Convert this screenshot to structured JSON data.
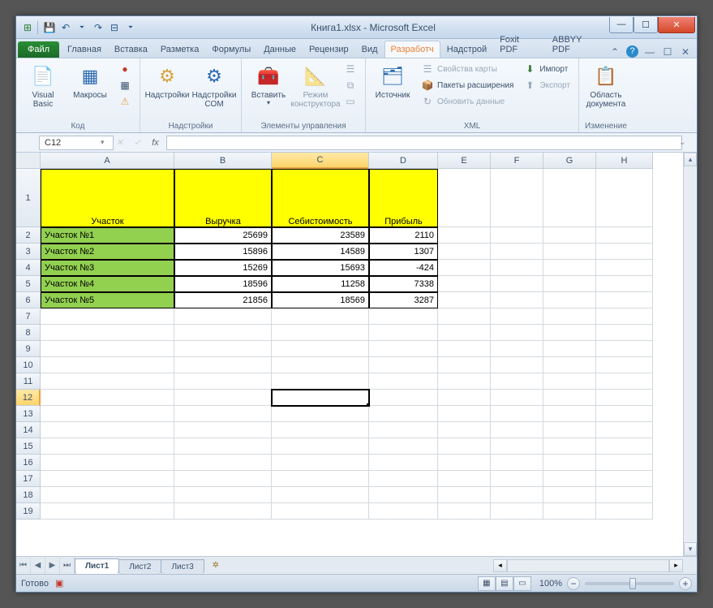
{
  "title": "Книга1.xlsx - Microsoft Excel",
  "qat": {
    "save": "💾",
    "undo": "↶",
    "redo": "↷",
    "more": "⏷"
  },
  "winbtns": {
    "min": "—",
    "max": "☐",
    "close": "✕"
  },
  "tabs": {
    "file": "Файл",
    "items": [
      "Главная",
      "Вставка",
      "Разметка",
      "Формулы",
      "Данные",
      "Рецензир",
      "Вид",
      "Разработч",
      "Надстрой",
      "Foxit PDF",
      "ABBYY PDF"
    ],
    "active": "Разработч"
  },
  "ribHelp": {
    "caret": "⌃",
    "help": "?",
    "minr": "—",
    "restr": "☐",
    "closer": "✕"
  },
  "ribbon": {
    "g1": {
      "vb": "Visual\nBasic",
      "mac": "Макросы",
      "label": "Код"
    },
    "g2": {
      "add": "Надстройки",
      "com": "Надстройки\nCOM",
      "label": "Надстройки"
    },
    "g3": {
      "ins": "Вставить",
      "des": "Режим\nконструктора",
      "label": "Элементы управления"
    },
    "g4": {
      "src": "Источник",
      "prop": "Свойства карты",
      "exp": "Пакеты расширения",
      "upd": "Обновить данные",
      "imp": "Импорт",
      "expo": "Экспорт",
      "label": "XML"
    },
    "g5": {
      "doc": "Область\nдокумента",
      "label": "Изменение"
    }
  },
  "namebox": "C12",
  "fx": "fx",
  "cols": [
    "A",
    "B",
    "C",
    "D",
    "E",
    "F",
    "G",
    "H"
  ],
  "colW": {
    "A": 165,
    "B": 120,
    "C": 120,
    "D": 85,
    "E": 65,
    "F": 65,
    "G": 65,
    "H": 70
  },
  "rowH": {
    "1": 72,
    "def": 20
  },
  "headers": [
    "Участок",
    "Выручка",
    "Себистоимость",
    "Прибыль"
  ],
  "data": [
    {
      "lab": "Участок №1",
      "b": "25699",
      "c": "23589",
      "d": "2110"
    },
    {
      "lab": "Участок №2",
      "b": "15896",
      "c": "14589",
      "d": "1307"
    },
    {
      "lab": "Участок №3",
      "b": "15269",
      "c": "15693",
      "d": "-424"
    },
    {
      "lab": "Участок №4",
      "b": "18596",
      "c": "11258",
      "d": "7338"
    },
    {
      "lab": "Участок №5",
      "b": "21856",
      "c": "18569",
      "d": "3287"
    }
  ],
  "selected": {
    "col": "C",
    "row": 12
  },
  "sheets": {
    "nav": [
      "⏮",
      "◀",
      "▶",
      "⏭"
    ],
    "tabs": [
      "Лист1",
      "Лист2",
      "Лист3"
    ],
    "active": "Лист1"
  },
  "status": {
    "ready": "Готово",
    "zoom": "100%"
  }
}
